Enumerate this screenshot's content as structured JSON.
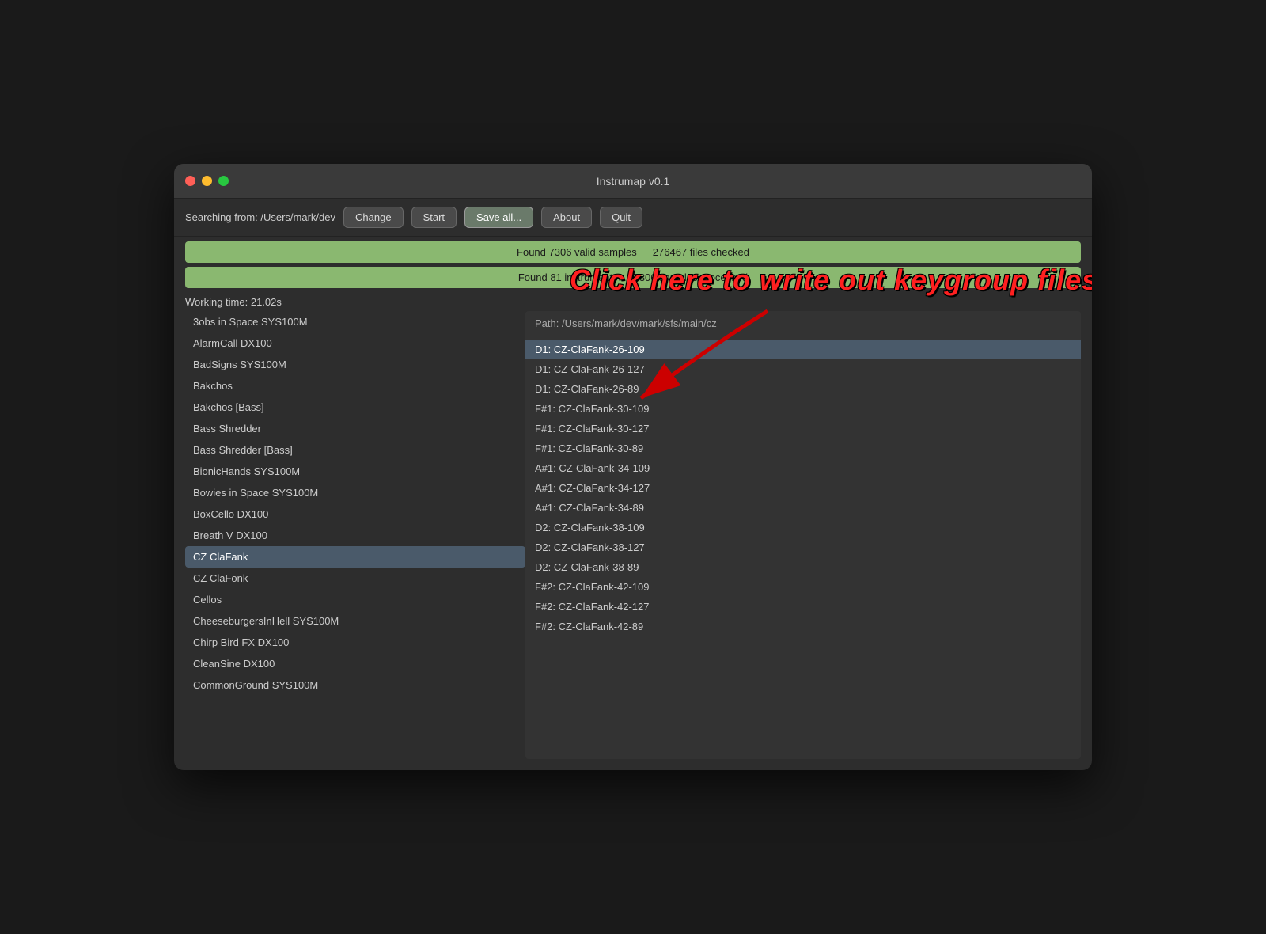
{
  "window": {
    "title": "Instrumap v0.1"
  },
  "toolbar": {
    "search_label": "Searching from: /Users/mark/dev",
    "change_btn": "Change",
    "start_btn": "Start",
    "save_all_btn": "Save all...",
    "about_btn": "About",
    "quit_btn": "Quit"
  },
  "status": {
    "bar1_left": "Found 7306 valid samples",
    "bar1_right": "276467 files checked",
    "bar2_left": "Found 81 instruments",
    "bar2_right": "7306 samples processed",
    "working_time": "Working time: 21.02s"
  },
  "annotation": {
    "text": "Click here to write out keygroup files"
  },
  "path": {
    "label": "Path: /Users/mark/dev/mark/sfs/main/cz"
  },
  "instruments": [
    "3obs in Space SYS100M",
    "AlarmCall DX100",
    "BadSigns SYS100M",
    "Bakchos",
    "Bakchos [Bass]",
    "Bass Shredder",
    "Bass Shredder [Bass]",
    "BionicHands SYS100M",
    "Bowies in Space SYS100M",
    "BoxCello DX100",
    "Breath V DX100",
    "CZ ClaFank",
    "CZ ClaFonk",
    "Cellos",
    "CheeseburgersInHell SYS100M",
    "Chirp Bird FX DX100",
    "CleanSine DX100",
    "CommonGround SYS100M"
  ],
  "selected_instrument": "CZ ClaFank",
  "samples": [
    "D1: CZ-ClaFank-26-109",
    "D1: CZ-ClaFank-26-127",
    "D1: CZ-ClaFank-26-89",
    "F#1: CZ-ClaFank-30-109",
    "F#1: CZ-ClaFank-30-127",
    "F#1: CZ-ClaFank-30-89",
    "A#1: CZ-ClaFank-34-109",
    "A#1: CZ-ClaFank-34-127",
    "A#1: CZ-ClaFank-34-89",
    "D2: CZ-ClaFank-38-109",
    "D2: CZ-ClaFank-38-127",
    "D2: CZ-ClaFank-38-89",
    "F#2: CZ-ClaFank-42-109",
    "F#2: CZ-ClaFank-42-127",
    "F#2: CZ-ClaFank-42-89"
  ]
}
